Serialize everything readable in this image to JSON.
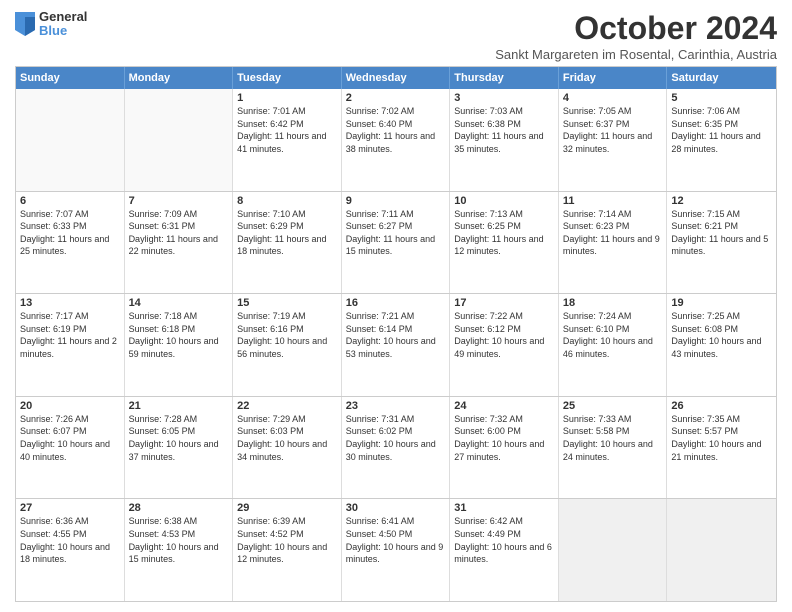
{
  "logo": {
    "general": "General",
    "blue": "Blue"
  },
  "title": "October 2024",
  "subtitle": "Sankt Margareten im Rosental, Carinthia, Austria",
  "headers": [
    "Sunday",
    "Monday",
    "Tuesday",
    "Wednesday",
    "Thursday",
    "Friday",
    "Saturday"
  ],
  "weeks": [
    [
      {
        "day": "",
        "info": ""
      },
      {
        "day": "",
        "info": ""
      },
      {
        "day": "1",
        "info": "Sunrise: 7:01 AM\nSunset: 6:42 PM\nDaylight: 11 hours and 41 minutes."
      },
      {
        "day": "2",
        "info": "Sunrise: 7:02 AM\nSunset: 6:40 PM\nDaylight: 11 hours and 38 minutes."
      },
      {
        "day": "3",
        "info": "Sunrise: 7:03 AM\nSunset: 6:38 PM\nDaylight: 11 hours and 35 minutes."
      },
      {
        "day": "4",
        "info": "Sunrise: 7:05 AM\nSunset: 6:37 PM\nDaylight: 11 hours and 32 minutes."
      },
      {
        "day": "5",
        "info": "Sunrise: 7:06 AM\nSunset: 6:35 PM\nDaylight: 11 hours and 28 minutes."
      }
    ],
    [
      {
        "day": "6",
        "info": "Sunrise: 7:07 AM\nSunset: 6:33 PM\nDaylight: 11 hours and 25 minutes."
      },
      {
        "day": "7",
        "info": "Sunrise: 7:09 AM\nSunset: 6:31 PM\nDaylight: 11 hours and 22 minutes."
      },
      {
        "day": "8",
        "info": "Sunrise: 7:10 AM\nSunset: 6:29 PM\nDaylight: 11 hours and 18 minutes."
      },
      {
        "day": "9",
        "info": "Sunrise: 7:11 AM\nSunset: 6:27 PM\nDaylight: 11 hours and 15 minutes."
      },
      {
        "day": "10",
        "info": "Sunrise: 7:13 AM\nSunset: 6:25 PM\nDaylight: 11 hours and 12 minutes."
      },
      {
        "day": "11",
        "info": "Sunrise: 7:14 AM\nSunset: 6:23 PM\nDaylight: 11 hours and 9 minutes."
      },
      {
        "day": "12",
        "info": "Sunrise: 7:15 AM\nSunset: 6:21 PM\nDaylight: 11 hours and 5 minutes."
      }
    ],
    [
      {
        "day": "13",
        "info": "Sunrise: 7:17 AM\nSunset: 6:19 PM\nDaylight: 11 hours and 2 minutes."
      },
      {
        "day": "14",
        "info": "Sunrise: 7:18 AM\nSunset: 6:18 PM\nDaylight: 10 hours and 59 minutes."
      },
      {
        "day": "15",
        "info": "Sunrise: 7:19 AM\nSunset: 6:16 PM\nDaylight: 10 hours and 56 minutes."
      },
      {
        "day": "16",
        "info": "Sunrise: 7:21 AM\nSunset: 6:14 PM\nDaylight: 10 hours and 53 minutes."
      },
      {
        "day": "17",
        "info": "Sunrise: 7:22 AM\nSunset: 6:12 PM\nDaylight: 10 hours and 49 minutes."
      },
      {
        "day": "18",
        "info": "Sunrise: 7:24 AM\nSunset: 6:10 PM\nDaylight: 10 hours and 46 minutes."
      },
      {
        "day": "19",
        "info": "Sunrise: 7:25 AM\nSunset: 6:08 PM\nDaylight: 10 hours and 43 minutes."
      }
    ],
    [
      {
        "day": "20",
        "info": "Sunrise: 7:26 AM\nSunset: 6:07 PM\nDaylight: 10 hours and 40 minutes."
      },
      {
        "day": "21",
        "info": "Sunrise: 7:28 AM\nSunset: 6:05 PM\nDaylight: 10 hours and 37 minutes."
      },
      {
        "day": "22",
        "info": "Sunrise: 7:29 AM\nSunset: 6:03 PM\nDaylight: 10 hours and 34 minutes."
      },
      {
        "day": "23",
        "info": "Sunrise: 7:31 AM\nSunset: 6:02 PM\nDaylight: 10 hours and 30 minutes."
      },
      {
        "day": "24",
        "info": "Sunrise: 7:32 AM\nSunset: 6:00 PM\nDaylight: 10 hours and 27 minutes."
      },
      {
        "day": "25",
        "info": "Sunrise: 7:33 AM\nSunset: 5:58 PM\nDaylight: 10 hours and 24 minutes."
      },
      {
        "day": "26",
        "info": "Sunrise: 7:35 AM\nSunset: 5:57 PM\nDaylight: 10 hours and 21 minutes."
      }
    ],
    [
      {
        "day": "27",
        "info": "Sunrise: 6:36 AM\nSunset: 4:55 PM\nDaylight: 10 hours and 18 minutes."
      },
      {
        "day": "28",
        "info": "Sunrise: 6:38 AM\nSunset: 4:53 PM\nDaylight: 10 hours and 15 minutes."
      },
      {
        "day": "29",
        "info": "Sunrise: 6:39 AM\nSunset: 4:52 PM\nDaylight: 10 hours and 12 minutes."
      },
      {
        "day": "30",
        "info": "Sunrise: 6:41 AM\nSunset: 4:50 PM\nDaylight: 10 hours and 9 minutes."
      },
      {
        "day": "31",
        "info": "Sunrise: 6:42 AM\nSunset: 4:49 PM\nDaylight: 10 hours and 6 minutes."
      },
      {
        "day": "",
        "info": ""
      },
      {
        "day": "",
        "info": ""
      }
    ]
  ]
}
